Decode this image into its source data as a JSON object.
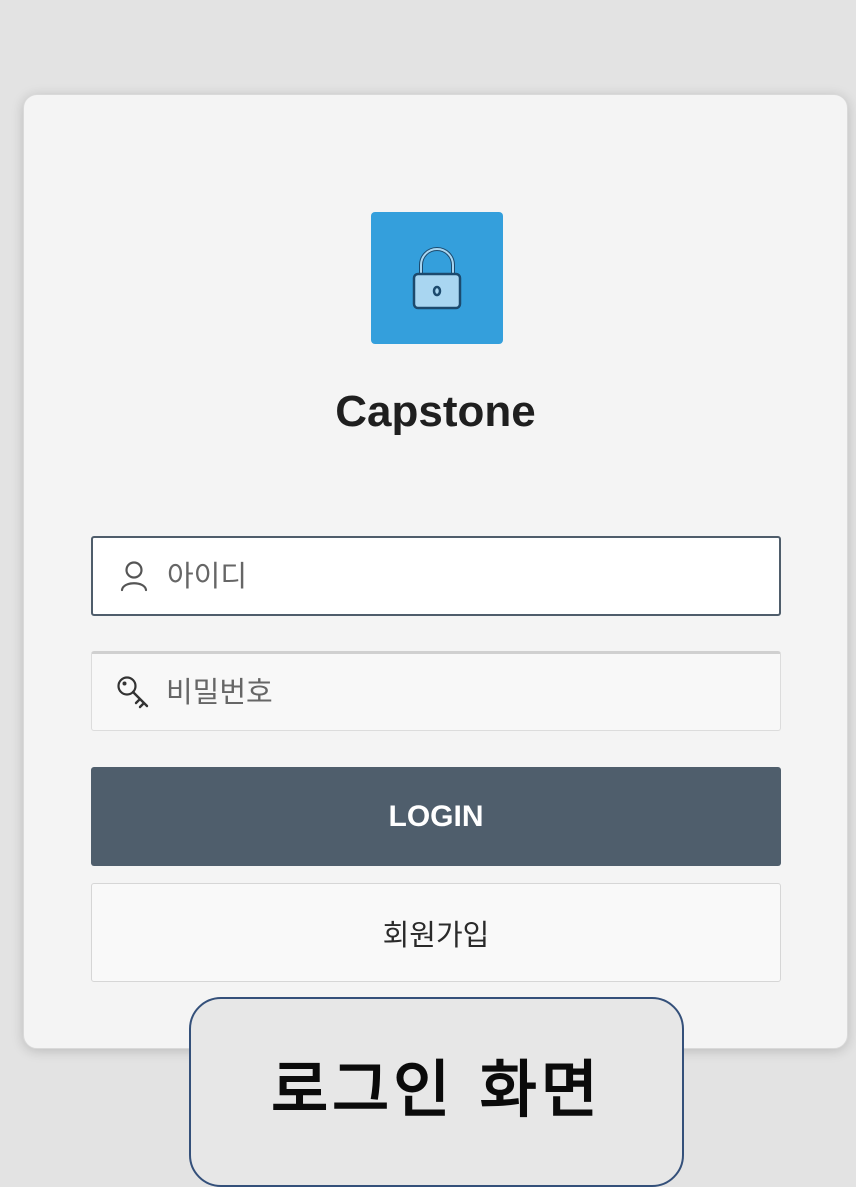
{
  "app": {
    "title": "Capstone",
    "icon": "lock-icon",
    "accent_color": "#349fdc"
  },
  "form": {
    "id_field": {
      "placeholder": "아이디",
      "value": "",
      "icon": "user-icon"
    },
    "password_field": {
      "placeholder": "비밀번호",
      "value": "",
      "icon": "key-icon"
    },
    "login_label": "LOGIN",
    "signup_label": "회원가입",
    "button_color": "#4f5e6c"
  },
  "caption": {
    "text": "로그인 화면"
  }
}
